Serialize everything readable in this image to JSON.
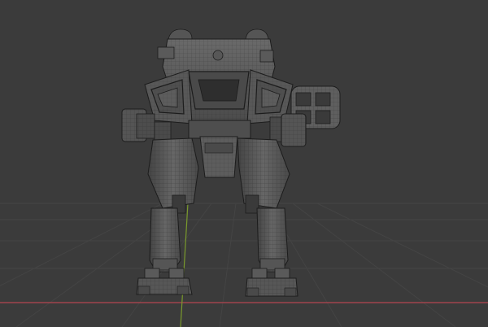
{
  "viewport": {
    "kind": "3d-viewport",
    "background": "#3b3b3b",
    "grid_color": "#444444",
    "x_axis_color": "#b5454f",
    "y_axis_color": "#7a9a2c",
    "model": {
      "name": "mech-wireframe-model",
      "base_color": "#5b5b5b",
      "shade_color": "#4a4a4a",
      "highlight_color": "#6a6a6a",
      "wire_color": "#1c1c1c"
    }
  }
}
